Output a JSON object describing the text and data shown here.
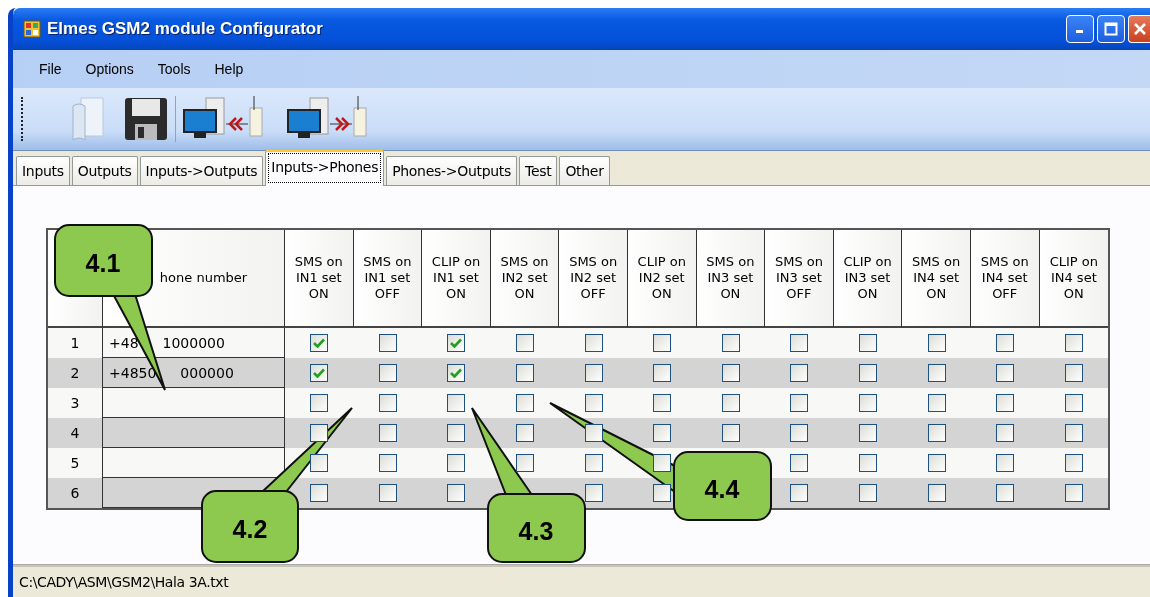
{
  "window": {
    "title": "Elmes GSM2 module Configurator"
  },
  "menu": [
    "File",
    "Options",
    "Tools",
    "Help"
  ],
  "toolbar": [
    {
      "kind": "open"
    },
    {
      "kind": "save"
    },
    {
      "kind": "read"
    },
    {
      "kind": "write"
    }
  ],
  "tabs": [
    {
      "label": "Inputs",
      "selected": false
    },
    {
      "label": "Outputs",
      "selected": false
    },
    {
      "label": "Inputs->Outputs",
      "selected": false
    },
    {
      "label": "Inputs->Phones",
      "selected": true
    },
    {
      "label": "Phones->Outputs",
      "selected": false
    },
    {
      "label": "Test",
      "selected": false
    },
    {
      "label": "Other",
      "selected": false
    }
  ],
  "table": {
    "columns": [
      "hone number",
      "SMS on IN1 set ON",
      "SMS on IN1 set OFF",
      "CLIP on IN1 set ON",
      "SMS on IN2 set ON",
      "SMS on IN2 set OFF",
      "CLIP on IN2 set ON",
      "SMS on IN3 set ON",
      "SMS on IN3 set OFF",
      "CLIP on IN3 set ON",
      "SMS on IN4 set ON",
      "SMS on IN4 set OFF",
      "CLIP on IN4 set ON"
    ],
    "rows": [
      {
        "number": "1",
        "phone_parts": [
          "+48",
          "1000000"
        ],
        "checks": [
          {
            "checked": true
          },
          {
            "checked": false
          },
          {
            "checked": true
          },
          {
            "checked": false
          },
          {
            "checked": false
          },
          {
            "checked": false
          },
          {
            "checked": false
          },
          {
            "checked": false
          },
          {
            "checked": false
          },
          {
            "checked": false
          },
          {
            "checked": false
          },
          {
            "checked": false
          }
        ]
      },
      {
        "number": "2",
        "phone_parts": [
          "+4850",
          "000000"
        ],
        "checks": [
          {
            "checked": true
          },
          {
            "checked": false
          },
          {
            "checked": true
          },
          {
            "checked": false
          },
          {
            "checked": false
          },
          {
            "checked": false
          },
          {
            "checked": false
          },
          {
            "checked": false
          },
          {
            "checked": false
          },
          {
            "checked": false
          },
          {
            "checked": false
          },
          {
            "checked": false
          }
        ]
      },
      {
        "number": "3",
        "checks": [
          {
            "checked": false
          },
          {
            "checked": false
          },
          {
            "checked": false
          },
          {
            "checked": false
          },
          {
            "checked": false
          },
          {
            "checked": false
          },
          {
            "checked": false
          },
          {
            "checked": false
          },
          {
            "checked": false
          },
          {
            "checked": false
          },
          {
            "checked": false
          },
          {
            "checked": false
          }
        ]
      },
      {
        "number": "4",
        "checks": [
          {
            "checked": false
          },
          {
            "checked": false
          },
          {
            "checked": false
          },
          {
            "checked": false
          },
          {
            "checked": false
          },
          {
            "checked": false
          },
          {
            "checked": false
          },
          {
            "checked": false
          },
          {
            "checked": false
          },
          {
            "checked": false
          },
          {
            "checked": false
          },
          {
            "checked": false
          }
        ]
      },
      {
        "number": "5",
        "checks": [
          {
            "checked": false
          },
          {
            "checked": false
          },
          {
            "checked": false
          },
          {
            "checked": false
          },
          {
            "checked": false
          },
          {
            "checked": false
          },
          {
            "covered": true
          },
          {
            "checked": false
          },
          {
            "checked": false
          },
          {
            "checked": false
          },
          {
            "checked": false
          },
          {
            "checked": false
          }
        ]
      },
      {
        "number": "6",
        "checks": [
          {
            "checked": false
          },
          {
            "checked": false
          },
          {
            "checked": false
          },
          {
            "covered": true
          },
          {
            "checked": false
          },
          {
            "checked": false
          },
          {
            "covered": true
          },
          {
            "checked": false
          },
          {
            "checked": false
          },
          {
            "checked": false
          },
          {
            "checked": false
          },
          {
            "checked": false
          }
        ]
      }
    ]
  },
  "callouts": [
    {
      "label": "4.1"
    },
    {
      "label": "4.2"
    },
    {
      "label": "4.3"
    },
    {
      "label": "4.4"
    }
  ],
  "status_bar": {
    "path": "C:\\CADY\\ASM\\GSM2\\Hala 3A.txt"
  }
}
